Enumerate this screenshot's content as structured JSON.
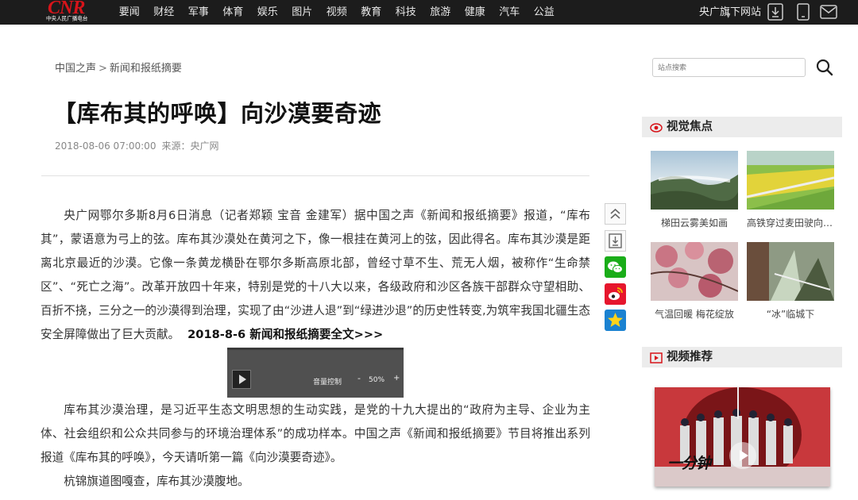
{
  "header": {
    "logo_mark": "CNR",
    "logo_sub": "中央人民广播电台",
    "nav": [
      "要闻",
      "财经",
      "军事",
      "体育",
      "娱乐",
      "图片",
      "视频",
      "教育",
      "科技",
      "旅游",
      "健康",
      "汽车",
      "公益"
    ],
    "sites_label": "央广旗下网站",
    "sites_caret": "▼",
    "icons": [
      "download-icon",
      "mobile-icon",
      "mail-icon"
    ]
  },
  "breadcrumb": {
    "home": "中国之声",
    "separator": ">",
    "current": "新闻和报纸摘要"
  },
  "article": {
    "title": "【库布其的呼唤】向沙漠要奇迹",
    "datetime": "2018-08-06 07:00:00",
    "source": "来源：央广网",
    "p1": "央广网鄂尔多斯8月6日消息（记者郑颖 宝音 金建军）据中国之声《新闻和报纸摘要》报道，“库布其”，蒙语意为弓上的弦。库布其沙漠处在黄河之下，像一根挂在黄河上的弦，因此得名。库布其沙漠是距离北京最近的沙漠。它像一条黄龙横卧在鄂尔多斯高原北部，曾经寸草不生、荒无人烟，被称作“生命禁区”、“死亡之海”。改革开放四十年来，特别是党的十八大以来，各级政府和沙区各族干部群众守望相助、百折不挠，三分之一的沙漠得到治理，实现了由“沙进人退”到“绿进沙退”的历史性转变,为筑牢我国北疆生态安全屏障做出了巨大贡献。",
    "full_link": "2018-8-6 新闻和报纸摘要全文>>>",
    "p2": "库布其沙漠治理，是习近平生态文明思想的生动实践，是党的十九大提出的“政府为主导、企业为主体、社会组织和公众共同参与的环境治理体系”的成功样本。中国之声《新闻和报纸摘要》节目将推出系列报道《库布其的呼唤》，今天请听第一篇《向沙漠要奇迹》。",
    "p3": "杭锦旗道图嘎查，库布其沙漠腹地。"
  },
  "player": {
    "volume_label": "音量控制",
    "minus": "-",
    "plus": "+",
    "volume_value": "50%",
    "volume_level": 0.5
  },
  "share": [
    "back-to-top-icon",
    "download-icon",
    "wechat-icon",
    "weibo-icon",
    "qzone-icon"
  ],
  "sidebar": {
    "search_placeholder": "站点搜索",
    "focus_title": "视觉焦点",
    "focus_items": [
      {
        "caption": "梯田云雾美如画"
      },
      {
        "caption": "高铁穿过麦田驶向远方"
      },
      {
        "caption": "气温回暖 梅花绽放"
      },
      {
        "caption": "“冰”临城下"
      }
    ],
    "video_title": "视频推荐",
    "video_callig": "一分钟"
  },
  "colors": {
    "topbar": "#1c1c1c",
    "brand_red": "#d7141a",
    "section_head": "#ececec",
    "player": "#505050"
  }
}
